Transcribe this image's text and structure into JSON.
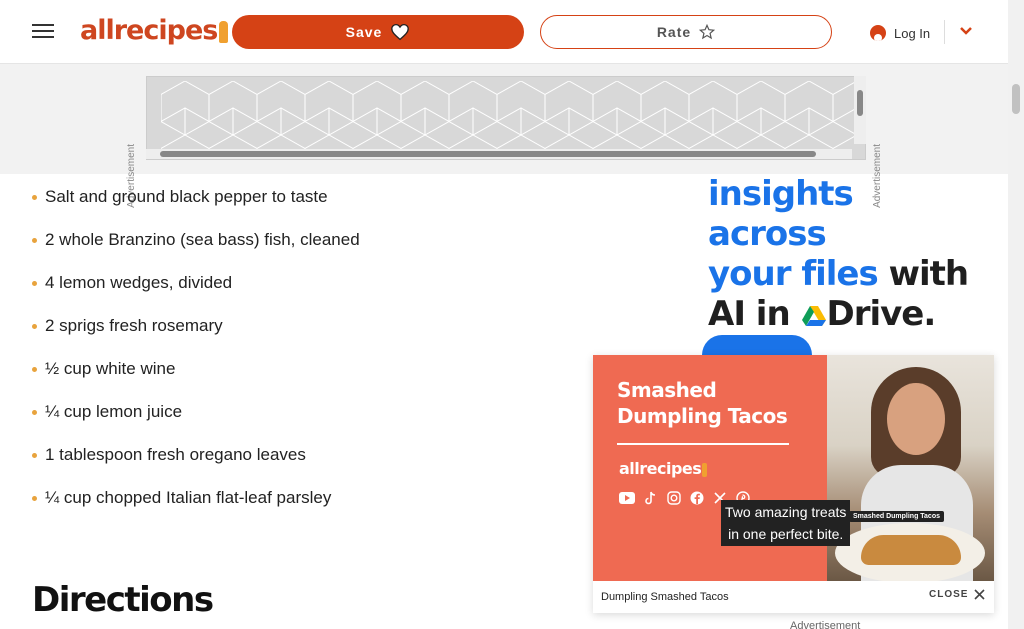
{
  "header": {
    "logo_text": "allrecipes",
    "save_label": "Save",
    "rate_label": "Rate",
    "login_label": "Log In"
  },
  "ads": {
    "label": "Advertisement",
    "side_ad": {
      "line1": "insights across",
      "line2_blue": "your files",
      "line2_dark": " with",
      "line3_a": "AI in ",
      "line3_b": "Drive."
    },
    "below_label": "Advertisement"
  },
  "ingredients": [
    "Salt and ground black pepper to taste",
    "2 whole Branzino (sea bass) fish, cleaned",
    "4 lemon wedges, divided",
    "2 sprigs fresh rosemary",
    "½ cup white wine",
    "¼ cup lemon juice",
    "1 tablespoon fresh oregano leaves",
    "¼ cup chopped Italian flat-leaf parsley"
  ],
  "directions_heading": "Directions",
  "video": {
    "title_line1": "Smashed",
    "title_line2": "Dumpling Tacos",
    "logo_text": "allrecipes",
    "caption_line1": "Two amazing treats",
    "caption_line2": "in one perfect bite.",
    "photo_tag": "Smashed Dumpling Tacos",
    "name": "Dumpling Smashed Tacos",
    "close_label": "CLOSE"
  },
  "colors": {
    "brand": "#d54215",
    "google_blue": "#1a73e8",
    "video_panel": "#ef6a52",
    "bullet": "#e8a33d"
  },
  "icons": {
    "menu": "hamburger-icon",
    "save": "heart-icon",
    "rate": "star-icon",
    "login": "user-icon",
    "dropdown": "chevron-down-icon",
    "close": "close-icon"
  }
}
